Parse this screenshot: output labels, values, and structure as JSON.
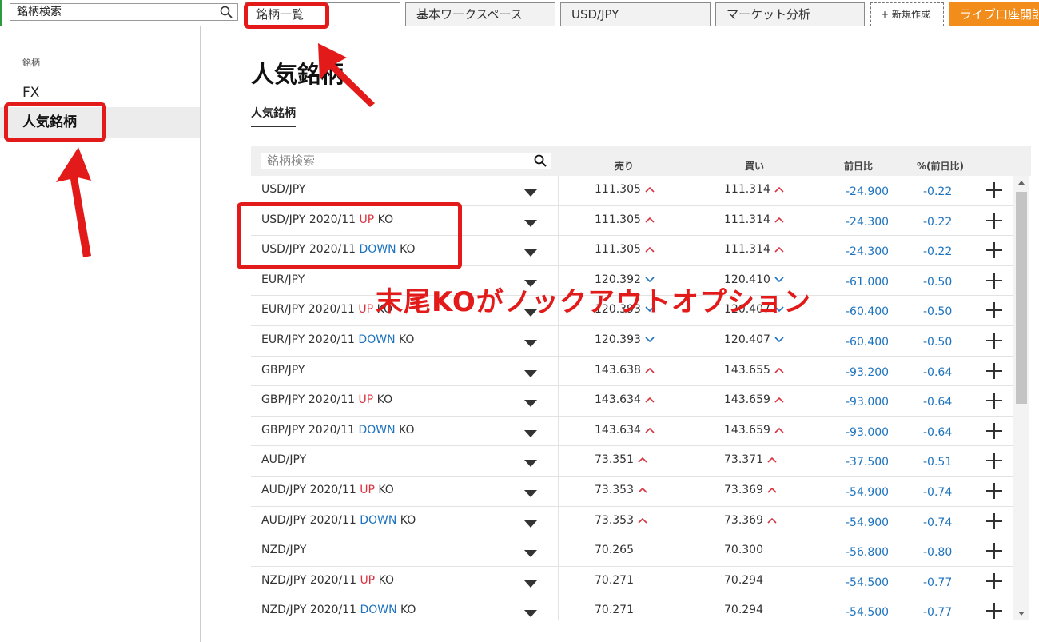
{
  "topbar": {
    "search_label": "銘柄検索",
    "tabs": [
      "銘柄一覧",
      "基本ワークスペース",
      "USD/JPY",
      "マーケット分析"
    ],
    "new_tab": "+ 新規作成",
    "live_account": "ライブ口座開設"
  },
  "sidebar": {
    "section": "銘柄",
    "items": [
      "FX",
      "人気銘柄"
    ]
  },
  "main": {
    "title": "人気銘柄",
    "subtab": "人気銘柄",
    "search_placeholder": "銘柄検索",
    "headers": {
      "sell": "売り",
      "buy": "買い",
      "change": "前日比",
      "percent": "%(前日比)"
    }
  },
  "colors": {
    "up": "#d9323f",
    "down": "#1e73be",
    "accent": "#f28c1b",
    "annotation": "#e21a1a"
  },
  "rows": [
    {
      "base": "USD/JPY",
      "tag": "",
      "suffix": "",
      "sell": "111.305",
      "sell_dir": "up",
      "buy": "111.314",
      "buy_dir": "up",
      "change": "-24.900",
      "pct": "-0.22"
    },
    {
      "base": "USD/JPY 2020/11 ",
      "tag": "UP",
      "suffix": " KO",
      "sell": "111.305",
      "sell_dir": "up",
      "buy": "111.314",
      "buy_dir": "up",
      "change": "-24.300",
      "pct": "-0.22"
    },
    {
      "base": "USD/JPY 2020/11 ",
      "tag": "DOWN",
      "suffix": " KO",
      "sell": "111.305",
      "sell_dir": "up",
      "buy": "111.314",
      "buy_dir": "up",
      "change": "-24.300",
      "pct": "-0.22"
    },
    {
      "base": "EUR/JPY",
      "tag": "",
      "suffix": "",
      "sell": "120.392",
      "sell_dir": "down",
      "buy": "120.410",
      "buy_dir": "down",
      "change": "-61.000",
      "pct": "-0.50"
    },
    {
      "base": "EUR/JPY 2020/11 ",
      "tag": "UP",
      "suffix": " KO",
      "sell": "120.393",
      "sell_dir": "down",
      "buy": "120.407",
      "buy_dir": "down",
      "change": "-60.400",
      "pct": "-0.50"
    },
    {
      "base": "EUR/JPY 2020/11 ",
      "tag": "DOWN",
      "suffix": " KO",
      "sell": "120.393",
      "sell_dir": "down",
      "buy": "120.407",
      "buy_dir": "down",
      "change": "-60.400",
      "pct": "-0.50"
    },
    {
      "base": "GBP/JPY",
      "tag": "",
      "suffix": "",
      "sell": "143.638",
      "sell_dir": "up",
      "buy": "143.655",
      "buy_dir": "up",
      "change": "-93.200",
      "pct": "-0.64"
    },
    {
      "base": "GBP/JPY 2020/11 ",
      "tag": "UP",
      "suffix": " KO",
      "sell": "143.634",
      "sell_dir": "up",
      "buy": "143.659",
      "buy_dir": "up",
      "change": "-93.000",
      "pct": "-0.64"
    },
    {
      "base": "GBP/JPY 2020/11 ",
      "tag": "DOWN",
      "suffix": " KO",
      "sell": "143.634",
      "sell_dir": "up",
      "buy": "143.659",
      "buy_dir": "up",
      "change": "-93.000",
      "pct": "-0.64"
    },
    {
      "base": "AUD/JPY",
      "tag": "",
      "suffix": "",
      "sell": "73.351",
      "sell_dir": "up",
      "buy": "73.371",
      "buy_dir": "up",
      "change": "-37.500",
      "pct": "-0.51"
    },
    {
      "base": "AUD/JPY 2020/11 ",
      "tag": "UP",
      "suffix": " KO",
      "sell": "73.353",
      "sell_dir": "up",
      "buy": "73.369",
      "buy_dir": "up",
      "change": "-54.900",
      "pct": "-0.74"
    },
    {
      "base": "AUD/JPY 2020/11 ",
      "tag": "DOWN",
      "suffix": " KO",
      "sell": "73.353",
      "sell_dir": "up",
      "buy": "73.369",
      "buy_dir": "up",
      "change": "-54.900",
      "pct": "-0.74"
    },
    {
      "base": "NZD/JPY",
      "tag": "",
      "suffix": "",
      "sell": "70.265",
      "sell_dir": "",
      "buy": "70.300",
      "buy_dir": "",
      "change": "-56.800",
      "pct": "-0.80"
    },
    {
      "base": "NZD/JPY 2020/11 ",
      "tag": "UP",
      "suffix": " KO",
      "sell": "70.271",
      "sell_dir": "",
      "buy": "70.294",
      "buy_dir": "",
      "change": "-54.500",
      "pct": "-0.77"
    },
    {
      "base": "NZD/JPY 2020/11 ",
      "tag": "DOWN",
      "suffix": " KO",
      "sell": "70.271",
      "sell_dir": "",
      "buy": "70.294",
      "buy_dir": "",
      "change": "-54.500",
      "pct": "-0.77"
    }
  ],
  "annotation": {
    "text": "末尾KOがノックアウトオプション"
  }
}
